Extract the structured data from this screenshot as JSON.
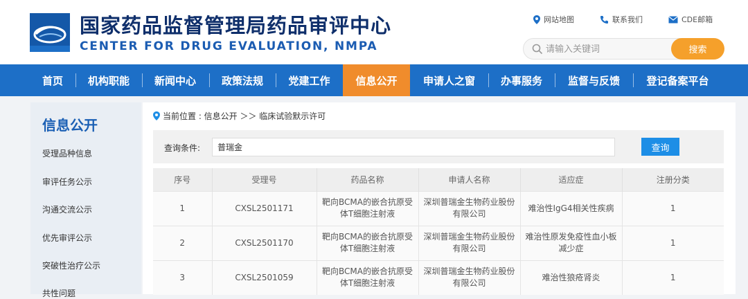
{
  "header": {
    "title_cn": "国家药品监督管理局药品审评中心",
    "title_en": "CENTER FOR DRUG EVALUATION, NMPA",
    "top_links": [
      {
        "label": "网站地图",
        "icon": "location-pin-icon"
      },
      {
        "label": "联系我们",
        "icon": "phone-icon"
      },
      {
        "label": "CDE邮箱",
        "icon": "mail-icon"
      }
    ],
    "search": {
      "placeholder": "请输入关键词",
      "button": "搜索"
    }
  },
  "nav": {
    "items": [
      {
        "label": "首页"
      },
      {
        "label": "机构职能"
      },
      {
        "label": "新闻中心"
      },
      {
        "label": "政策法规"
      },
      {
        "label": "党建工作"
      },
      {
        "label": "信息公开"
      },
      {
        "label": "申请人之窗"
      },
      {
        "label": "办事服务"
      },
      {
        "label": "监督与反馈"
      },
      {
        "label": "登记备案平台"
      }
    ],
    "active": "信息公开"
  },
  "sidebar": {
    "title": "信息公开",
    "items": [
      {
        "label": "受理品种信息"
      },
      {
        "label": "审评任务公示"
      },
      {
        "label": "沟通交流公示"
      },
      {
        "label": "优先审评公示"
      },
      {
        "label": "突破性治疗公示"
      },
      {
        "label": "共性问题"
      }
    ]
  },
  "breadcrumb": {
    "text": "当前位置 : 信息公开 ＞＞ 临床试验默示许可"
  },
  "query": {
    "label": "查询条件:",
    "value": "普瑞金",
    "button": "查询"
  },
  "table": {
    "headers": [
      "序号",
      "受理号",
      "药品名称",
      "申请人名称",
      "适应症",
      "注册分类"
    ],
    "rows": [
      [
        "1",
        "CXSL2501171",
        "靶向BCMA的嵌合抗原受体T细胞注射液",
        "深圳普瑞金生物药业股份有限公司",
        "难治性IgG4相关性疾病",
        "1"
      ],
      [
        "2",
        "CXSL2501170",
        "靶向BCMA的嵌合抗原受体T细胞注射液",
        "深圳普瑞金生物药业股份有限公司",
        "难治性原发免疫性血小板减少症",
        "1"
      ],
      [
        "3",
        "CXSL2501059",
        "靶向BCMA的嵌合抗原受体T细胞注射液",
        "深圳普瑞金生物药业股份有限公司",
        "难治性狼疮肾炎",
        "1"
      ]
    ]
  },
  "colors": {
    "nav_bg": "#1d6fc7",
    "nav_active": "#f08c2c",
    "search_button": "#f5a02b",
    "query_button": "#1d8ee6",
    "title": "#0f2f6b"
  }
}
